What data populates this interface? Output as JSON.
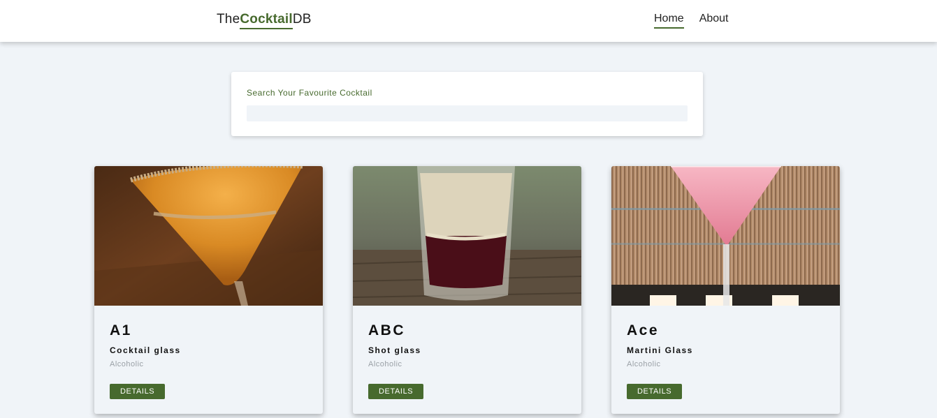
{
  "header": {
    "logo": {
      "prefix": "The",
      "accent": "Cocktail",
      "suffix": "DB"
    },
    "nav": [
      {
        "label": "Home",
        "active": true
      },
      {
        "label": "About",
        "active": false
      }
    ]
  },
  "search": {
    "label": "Search Your Favourite Cocktail",
    "value": ""
  },
  "cocktails": [
    {
      "name": "A1",
      "glass": "Cocktail glass",
      "type": "Alcoholic",
      "button": "DETAILS"
    },
    {
      "name": "ABC",
      "glass": "Shot glass",
      "type": "Alcoholic",
      "button": "DETAILS"
    },
    {
      "name": "Ace",
      "glass": "Martini Glass",
      "type": "Alcoholic",
      "button": "DETAILS"
    }
  ],
  "colors": {
    "accent": "#476a2e",
    "background": "#f0f4f8",
    "surface": "#ffffff",
    "muted_text": "#9aa0a6"
  }
}
